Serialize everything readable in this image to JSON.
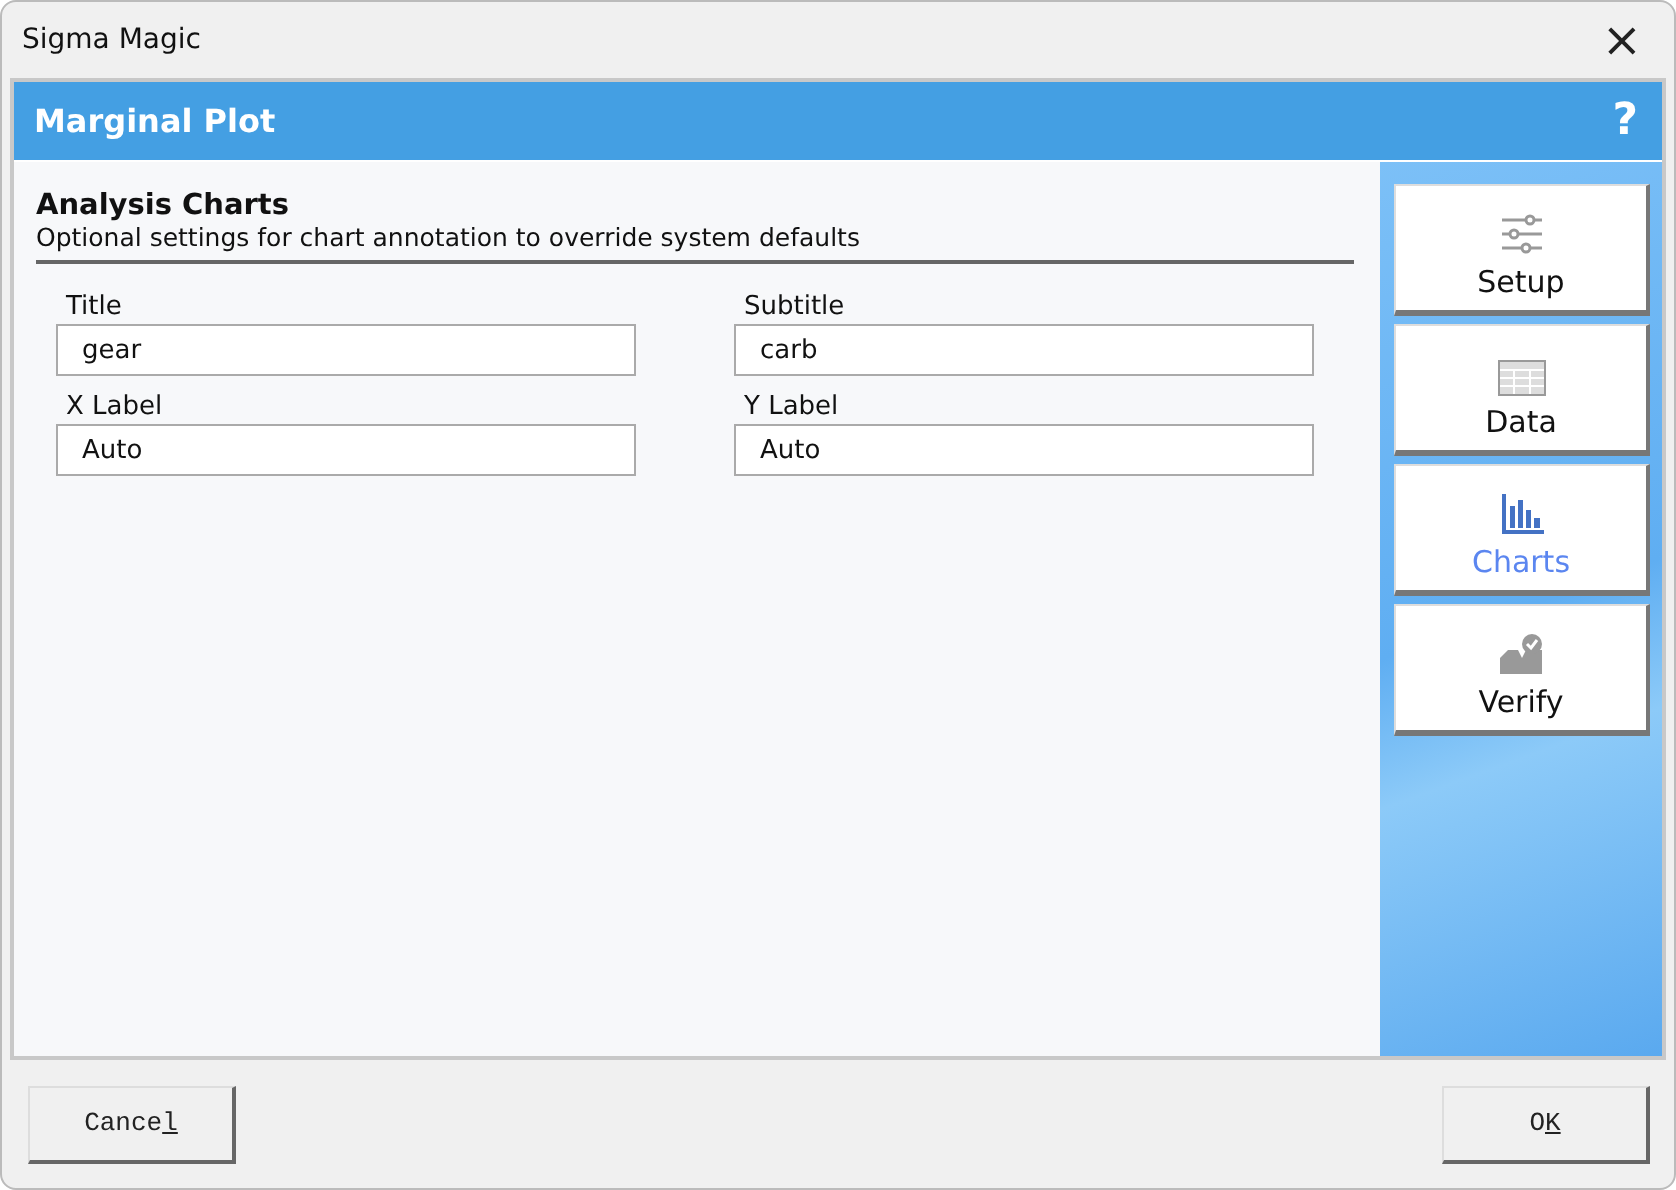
{
  "window": {
    "title": "Sigma Magic",
    "close": "×"
  },
  "header": {
    "title": "Marginal Plot",
    "help": "?"
  },
  "section": {
    "title": "Analysis Charts",
    "subtitle": "Optional settings for chart annotation to override system defaults"
  },
  "fields": [
    {
      "label": "Title",
      "value": "gear"
    },
    {
      "label": "Subtitle",
      "value": "carb"
    },
    {
      "label": "X Label",
      "value": "Auto"
    },
    {
      "label": "Y Label",
      "value": "Auto"
    }
  ],
  "nav": [
    {
      "label": "Setup",
      "kind": "sliders",
      "selected": false
    },
    {
      "label": "Data",
      "kind": "table",
      "selected": false
    },
    {
      "label": "Charts",
      "kind": "chart",
      "selected": true
    },
    {
      "label": "Verify",
      "kind": "verify",
      "selected": false
    }
  ],
  "buttons": [
    {
      "text": "Cance",
      "accel": "l"
    },
    {
      "text": "O",
      "accel": "K"
    }
  ]
}
